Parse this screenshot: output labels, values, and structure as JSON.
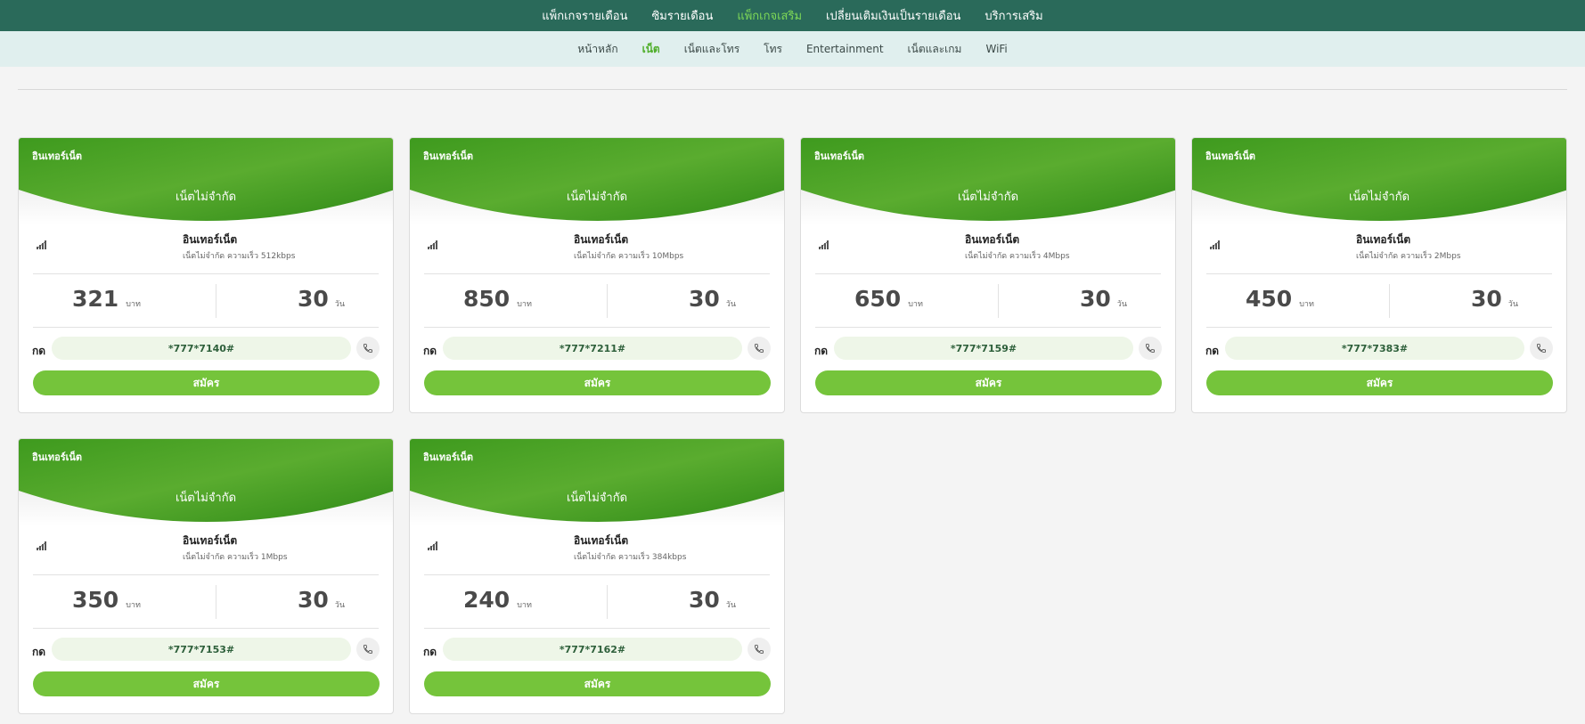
{
  "colors": {
    "topnav_bg": "#2a6a5a",
    "subnav_bg": "#e0efee",
    "accent_green": "#75c43b",
    "card_header_green": "#3d9a1f"
  },
  "topnav": {
    "items": [
      {
        "label": "แพ็กเกจรายเดือน",
        "active": false
      },
      {
        "label": "ซิมรายเดือน",
        "active": false
      },
      {
        "label": "แพ็กเกจเสริม",
        "active": true
      },
      {
        "label": "เปลี่ยนเติมเงินเป็นรายเดือน",
        "active": false
      },
      {
        "label": "บริการเสริม",
        "active": false
      }
    ]
  },
  "subnav": {
    "items": [
      {
        "label": "หน้าหลัก",
        "active": false
      },
      {
        "label": "เน็ต",
        "active": true
      },
      {
        "label": "เน็ตและโทร",
        "active": false
      },
      {
        "label": "โทร",
        "active": false
      },
      {
        "label": "Entertainment",
        "active": false
      },
      {
        "label": "เน็ตและเกม",
        "active": false
      },
      {
        "label": "WiFi",
        "active": false
      }
    ]
  },
  "card_labels": {
    "dial_label": "กด",
    "signup_label": "สมัคร",
    "price_unit": "บาท",
    "days_unit": "วัน",
    "signal_icon": "signal-bars-icon",
    "call_icon": "phone-icon"
  },
  "cards": [
    {
      "tag": "อินเทอร์เน็ต",
      "title": "เน็ตไม่จำกัด",
      "plan_name": "อินเทอร์เน็ต",
      "plan_desc": "เน็ตไม่จำกัด ความเร็ว 512kbps",
      "price": "321",
      "days": "30",
      "code": "*777*7140#"
    },
    {
      "tag": "อินเทอร์เน็ต",
      "title": "เน็ตไม่จำกัด",
      "plan_name": "อินเทอร์เน็ต",
      "plan_desc": "เน็ตไม่จำกัด ความเร็ว 10Mbps",
      "price": "850",
      "days": "30",
      "code": "*777*7211#"
    },
    {
      "tag": "อินเทอร์เน็ต",
      "title": "เน็ตไม่จำกัด",
      "plan_name": "อินเทอร์เน็ต",
      "plan_desc": "เน็ตไม่จำกัด ความเร็ว 4Mbps",
      "price": "650",
      "days": "30",
      "code": "*777*7159#"
    },
    {
      "tag": "อินเทอร์เน็ต",
      "title": "เน็ตไม่จำกัด",
      "plan_name": "อินเทอร์เน็ต",
      "plan_desc": "เน็ตไม่จำกัด ความเร็ว 2Mbps",
      "price": "450",
      "days": "30",
      "code": "*777*7383#"
    },
    {
      "tag": "อินเทอร์เน็ต",
      "title": "เน็ตไม่จำกัด",
      "plan_name": "อินเทอร์เน็ต",
      "plan_desc": "เน็ตไม่จำกัด ความเร็ว 1Mbps",
      "price": "350",
      "days": "30",
      "code": "*777*7153#"
    },
    {
      "tag": "อินเทอร์เน็ต",
      "title": "เน็ตไม่จำกัด",
      "plan_name": "อินเทอร์เน็ต",
      "plan_desc": "เน็ตไม่จำกัด ความเร็ว 384kbps",
      "price": "240",
      "days": "30",
      "code": "*777*7162#"
    }
  ]
}
